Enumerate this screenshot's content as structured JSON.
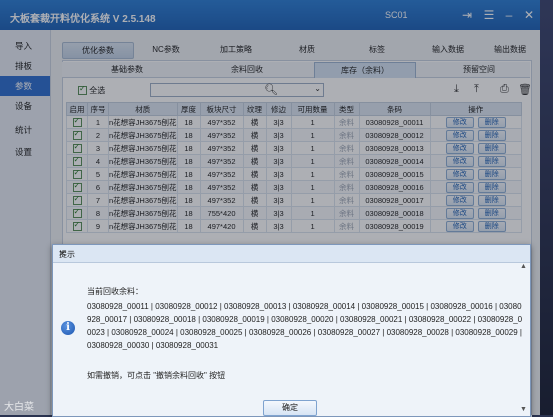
{
  "app": {
    "title": "大板套裁开料优化系统 V 2.5.148",
    "station": "SC01"
  },
  "sidebar": {
    "items": [
      {
        "label": "导入",
        "active": false
      },
      {
        "label": "排板",
        "active": false
      },
      {
        "label": "参数",
        "active": true
      },
      {
        "label": "设备",
        "active": false
      },
      {
        "label": "统计",
        "active": false
      },
      {
        "label": "设置",
        "active": false
      }
    ]
  },
  "top_tabs": [
    "优化参数",
    "NC参数",
    "加工策略",
    "材质",
    "标签",
    "输入数据",
    "输出数据"
  ],
  "sub_tabs": [
    "基础参数",
    "余料回收",
    "库存（余料）",
    "预留空间"
  ],
  "toolbar": {
    "select_all_label": "全选",
    "select_value": ""
  },
  "table": {
    "headers": [
      "启用",
      "序号",
      "材质",
      "厚度",
      "板块尺寸",
      "纹理",
      "修边",
      "可用数量",
      "类型",
      "条码",
      "操作"
    ],
    "edit_label": "修改",
    "delete_label": "删除",
    "rows": [
      {
        "no": "1",
        "material": "n花想容JH3675刨花",
        "thickness": "18",
        "size": "497*352",
        "grain": "横",
        "trim": "3|3",
        "qty": "1",
        "type": "余料",
        "code": "03080928_00011"
      },
      {
        "no": "2",
        "material": "n花想容JH3675刨花",
        "thickness": "18",
        "size": "497*352",
        "grain": "横",
        "trim": "3|3",
        "qty": "1",
        "type": "余料",
        "code": "03080928_00012"
      },
      {
        "no": "3",
        "material": "n花想容JH3675刨花",
        "thickness": "18",
        "size": "497*352",
        "grain": "横",
        "trim": "3|3",
        "qty": "1",
        "type": "余料",
        "code": "03080928_00013"
      },
      {
        "no": "4",
        "material": "n花想容JH3675刨花",
        "thickness": "18",
        "size": "497*352",
        "grain": "横",
        "trim": "3|3",
        "qty": "1",
        "type": "余料",
        "code": "03080928_00014"
      },
      {
        "no": "5",
        "material": "n花想容JH3675刨花",
        "thickness": "18",
        "size": "497*352",
        "grain": "横",
        "trim": "3|3",
        "qty": "1",
        "type": "余料",
        "code": "03080928_00015"
      },
      {
        "no": "6",
        "material": "n花想容JH3675刨花",
        "thickness": "18",
        "size": "497*352",
        "grain": "横",
        "trim": "3|3",
        "qty": "1",
        "type": "余料",
        "code": "03080928_00016"
      },
      {
        "no": "7",
        "material": "n花想容JH3675刨花",
        "thickness": "18",
        "size": "497*352",
        "grain": "横",
        "trim": "3|3",
        "qty": "1",
        "type": "余料",
        "code": "03080928_00017"
      },
      {
        "no": "8",
        "material": "n花想容JH3675刨花",
        "thickness": "18",
        "size": "755*420",
        "grain": "横",
        "trim": "3|3",
        "qty": "1",
        "type": "余料",
        "code": "03080928_00018"
      },
      {
        "no": "9",
        "material": "n花想容JH3675刨花",
        "thickness": "18",
        "size": "497*420",
        "grain": "横",
        "trim": "3|3",
        "qty": "1",
        "type": "余料",
        "code": "03080928_00019"
      }
    ]
  },
  "dialog": {
    "title": "提示",
    "heading": "当前回收余料：",
    "codes": "03080928_00011 | 03080928_00012 | 03080928_00013 | 03080928_00014 | 03080928_00015 | 03080928_00016 | 03080928_00017 | 03080928_00018 | 03080928_00019 | 03080928_00020 | 03080928_00021 | 03080928_00022 | 03080928_00023 | 03080928_00024 | 03080928_00025 | 03080928_00026 | 03080928_00027 | 03080928_00028 | 03080928_00029 | 03080928_00030 | 03080928_00031",
    "note": "如需撤销，可点击 \"撤销余料回收\" 按钮",
    "ok_label": "确定"
  },
  "watermark": "大白菜"
}
